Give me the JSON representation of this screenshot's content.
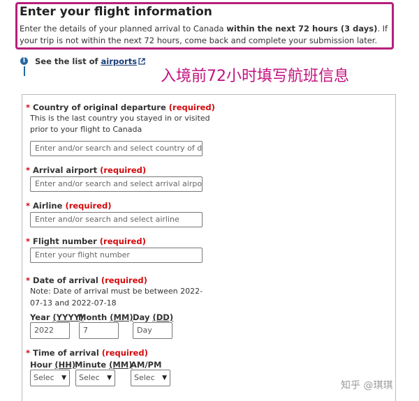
{
  "header": {
    "title": "Enter your flight information",
    "intro_pre": "Enter the details of your planned arrival to Canada ",
    "intro_bold": "within the next 72 hours (3 days)",
    "intro_post": ". If your trip is not within the next 72 hours, come back and complete your submission later."
  },
  "info": {
    "icon": "info-icon",
    "see_prefix": "See the list of ",
    "airports_link": "airports",
    "external_icon": "external-link-icon"
  },
  "annotation": "入境前72小时填写航班信息",
  "required_marker": "*",
  "required_text": "(required)",
  "fields": {
    "country": {
      "label": "Country of original departure",
      "hint_line1": "This is the last country you stayed in or visited",
      "hint_line2": "prior to your flight to Canada",
      "placeholder": "Enter and/or search and select country of de|"
    },
    "airport": {
      "label": "Arrival airport",
      "placeholder": "Enter and/or search and select arrival airport"
    },
    "airline": {
      "label": "Airline",
      "placeholder": "Enter and/or search and select airline"
    },
    "flight_number": {
      "label": "Flight number",
      "placeholder": "Enter your flight number"
    },
    "date": {
      "label": "Date of arrival",
      "note_line1": "Note: Date of arrival must be between 2022-",
      "note_line2": "07-13 and 2022-07-18",
      "year_label": "Year",
      "year_fmt": "(YYYY)",
      "year_value": "2022",
      "month_label": "Month",
      "month_fmt": "(MM)",
      "month_value": "7",
      "day_label": "Day",
      "day_fmt": "(DD)",
      "day_placeholder": "Day"
    },
    "time": {
      "label": "Time of arrival",
      "hour_label": "Hour",
      "hour_fmt": "(HH)",
      "minute_label": "Minute",
      "minute_fmt": "(MM)",
      "ampm_label": "AM/PM",
      "select_text": "Selec"
    }
  },
  "watermark": "知乎 @琪琪",
  "colors": {
    "highlight_border": "#b61f7a",
    "required_red": "#d3080c",
    "annotation_magenta": "#c3127e",
    "link_blue": "#1a3d7a",
    "info_blue": "#26689e"
  }
}
